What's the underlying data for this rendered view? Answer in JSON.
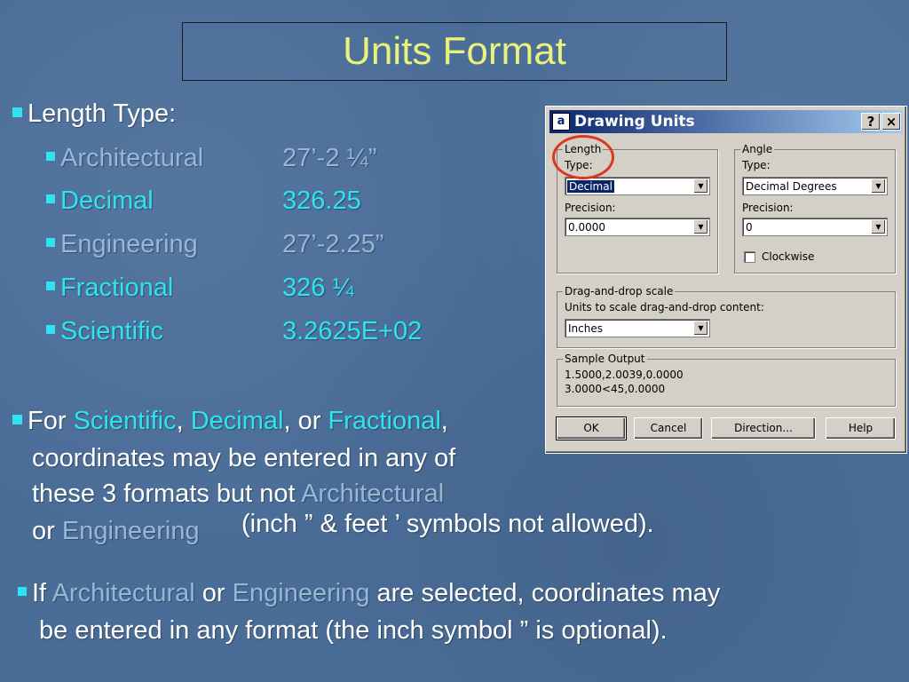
{
  "slide": {
    "title": "Units Format",
    "length_type_heading": "Length Type:",
    "length_types": [
      {
        "name": "Architectural",
        "example": "27’-2 ¼”"
      },
      {
        "name": "Decimal",
        "example": "326.25"
      },
      {
        "name": "Engineering",
        "example": "27’-2.25”"
      },
      {
        "name": "Fractional",
        "example": "326 ¼"
      },
      {
        "name": "Scientific",
        "example": "3.2625E+02"
      }
    ],
    "para1": {
      "for": "For ",
      "scientific": "Scientific",
      "comma1": ", ",
      "decimal": "Decimal",
      "or1": ", or ",
      "fractional": "Fractional",
      "comma2": ",",
      "line2": "coordinates may be entered in any of",
      "line3a": "these 3 formats but not ",
      "architectural": "Architectural",
      "line4a": "or ",
      "engineering": "Engineering",
      "line4b": "(inch ” & feet ’ symbols not allowed)."
    },
    "para2": {
      "if": "If ",
      "architectural": "Architectural",
      "or": " or ",
      "engineering": "Engineering",
      "rest1": " are selected, coordinates may",
      "line2": "be entered in any format (the inch symbol ” is optional)."
    }
  },
  "dialog": {
    "title": "Drawing Units",
    "help_btn": "?",
    "close_btn": "×",
    "length_group": "Length",
    "length_type_label": "Type:",
    "length_type_value": "Decimal",
    "length_precision_label": "Precision:",
    "length_precision_value": "0.0000",
    "angle_group": "Angle",
    "angle_type_label": "Type:",
    "angle_type_value": "Decimal Degrees",
    "angle_precision_label": "Precision:",
    "angle_precision_value": "0",
    "clockwise_label": "Clockwise",
    "dnd_group": "Drag-and-drop scale",
    "dnd_label": "Units to scale drag-and-drop content:",
    "dnd_value": "Inches",
    "sample_group": "Sample Output",
    "sample_line1": "1.5000,2.0039,0.0000",
    "sample_line2": "3.0000<45,0.0000",
    "ok": "OK",
    "cancel": "Cancel",
    "direction": "Direction...",
    "help": "Help"
  },
  "colors": {
    "background": "#4a6d98",
    "title": "#e9f27a",
    "highlight": "#2ee3f2",
    "dim_term": "#95b7d8",
    "annotation_circle": "#e0361c"
  }
}
